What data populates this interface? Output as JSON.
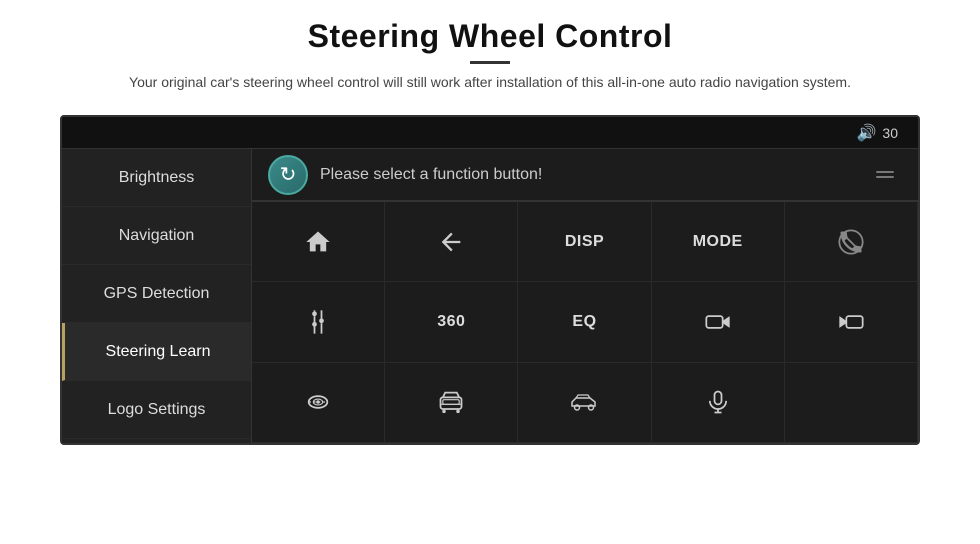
{
  "header": {
    "title": "Steering Wheel Control",
    "subtitle": "Your original car's steering wheel control will still work after installation of this all-in-one auto radio navigation system."
  },
  "topbar": {
    "volume_icon": "🔊",
    "volume_value": "30"
  },
  "sidebar": {
    "items": [
      {
        "label": "Brightness",
        "active": false
      },
      {
        "label": "Navigation",
        "active": false
      },
      {
        "label": "GPS Detection",
        "active": false
      },
      {
        "label": "Steering Learn",
        "active": true
      },
      {
        "label": "Logo Settings",
        "active": false
      }
    ]
  },
  "main": {
    "function_message": "Please select a function button!",
    "buttons": [
      {
        "row": 0,
        "col": 0,
        "type": "icon",
        "label": "home"
      },
      {
        "row": 0,
        "col": 1,
        "type": "icon",
        "label": "back"
      },
      {
        "row": 0,
        "col": 2,
        "type": "text",
        "label": "DISP"
      },
      {
        "row": 0,
        "col": 3,
        "type": "text",
        "label": "MODE"
      },
      {
        "row": 0,
        "col": 4,
        "type": "icon",
        "label": "phone-slash"
      },
      {
        "row": 1,
        "col": 0,
        "type": "icon",
        "label": "tune"
      },
      {
        "row": 1,
        "col": 1,
        "type": "text",
        "label": "360"
      },
      {
        "row": 1,
        "col": 2,
        "type": "text",
        "label": "EQ"
      },
      {
        "row": 1,
        "col": 3,
        "type": "icon",
        "label": "camera"
      },
      {
        "row": 1,
        "col": 4,
        "type": "icon",
        "label": "camera-alt"
      },
      {
        "row": 2,
        "col": 0,
        "type": "icon",
        "label": "car"
      },
      {
        "row": 2,
        "col": 1,
        "type": "icon",
        "label": "car-front"
      },
      {
        "row": 2,
        "col": 2,
        "type": "icon",
        "label": "car-side"
      },
      {
        "row": 2,
        "col": 3,
        "type": "icon",
        "label": "mic"
      },
      {
        "row": 2,
        "col": 4,
        "type": "empty"
      }
    ]
  }
}
